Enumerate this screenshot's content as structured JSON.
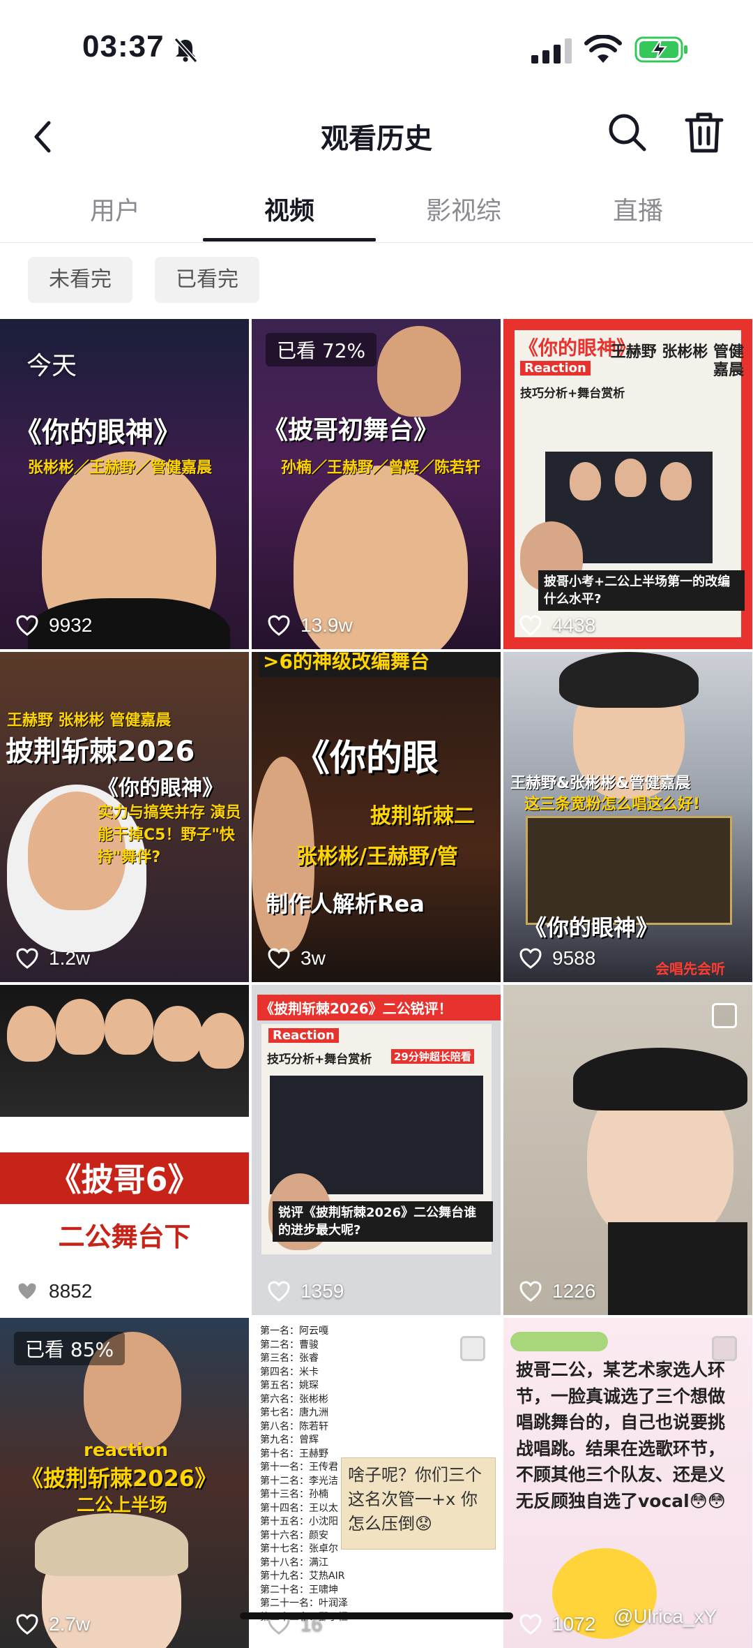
{
  "status_bar": {
    "time": "03:37"
  },
  "header": {
    "title": "观看历史"
  },
  "tabs": [
    {
      "label": "用户"
    },
    {
      "label": "视频"
    },
    {
      "label": "影视综"
    },
    {
      "label": "直播"
    }
  ],
  "filters": [
    {
      "label": "未看完"
    },
    {
      "label": "已看完"
    }
  ],
  "videos": [
    {
      "badge": "今天",
      "title": "《你的眼神》",
      "subtitle": "张彬彬／王赫野／管健嘉晨",
      "likes": "9932"
    },
    {
      "badge": "已看 72%",
      "title": "《披哥初舞台》",
      "subtitle": "孙楠／王赫野／曾辉／陈若轩",
      "likes": "13.9w"
    },
    {
      "title": "《你的眼神》",
      "tag": "Reaction",
      "subtitle": "技巧分析+舞台赏析",
      "names": "王赫野 张彬彬 管健嘉晨",
      "caption": "披哥小考+二公上半场第一的改编什么水平?",
      "likes": "4438"
    },
    {
      "names": "王赫野 张彬彬 管健嘉晨",
      "title": "披荆斩棘2026",
      "subtitle": "《你的眼神》",
      "caption": "实力与搞笑并存 演员能干掉C5！野子\"快持\"舞伴?",
      "likes": "1.2w"
    },
    {
      "title": "《你的眼",
      "subtitle": "披荆斩棘二",
      "names": "张彬彬/王赫野/管",
      "caption": "制作人解析Rea",
      "top": ">6的神级改编舞台",
      "likes": "3w"
    },
    {
      "names": "王赫野&张彬彬&管健嘉晨",
      "caption": "这三条宽粉怎么唱这么好!",
      "title": "《你的眼神》",
      "footer": "会唱先会听",
      "likes": "9588"
    },
    {
      "title": "《披哥6》",
      "subtitle": "二公舞台下",
      "likes": "8852"
    },
    {
      "title": "《披荆斩棘2026》二公锐评！",
      "tag": "Reaction",
      "subtitle": "技巧分析+舞台赏析",
      "extra": "29分钟超长陪看",
      "caption": "锐评《披荆斩棘2026》二公舞台谁的进步最大呢?",
      "likes": "1359"
    },
    {
      "likes": "1226"
    },
    {
      "badge": "已看 85%",
      "tag": "reaction",
      "title": "《披荆斩棘2026》",
      "subtitle": "二公上半场",
      "likes": "2.7w"
    },
    {
      "ranking": [
        "第一名：阿云嘎",
        "第二名：曹骏",
        "第三名：张睿",
        "第四名：米卡",
        "第五名：姚琛",
        "第六名：张彬彬",
        "第七名：唐九洲",
        "第八名：陈若轩",
        "第九名：曾辉",
        "第十名：王赫野",
        "第十一名：王传君",
        "第十二名：李光洁",
        "第十三名：孙楠",
        "第十四名：王以太",
        "第十五名：小沈阳",
        "第十六名：颜安",
        "第十七名：张卓尔",
        "第十八名：满江",
        "第十九名：艾热AIR",
        "第二十名：王啸坤",
        "第二十一名：叶润泽",
        "第二十二名：邵子恒"
      ],
      "note": "啥子呢？你们三个这名次管一+x 你怎么压倒😟",
      "likes": "16"
    },
    {
      "text": "披哥二公，某艺术家选人环节，一脸真诚选了三个想做唱跳舞台的，自己也说要挑战唱跳。结果在选歌环节，不顾其他三个队友、还是义无反顾独自选了vocal😳😳",
      "likes": "1072"
    }
  ],
  "watermark": "@Ulrica_xY"
}
